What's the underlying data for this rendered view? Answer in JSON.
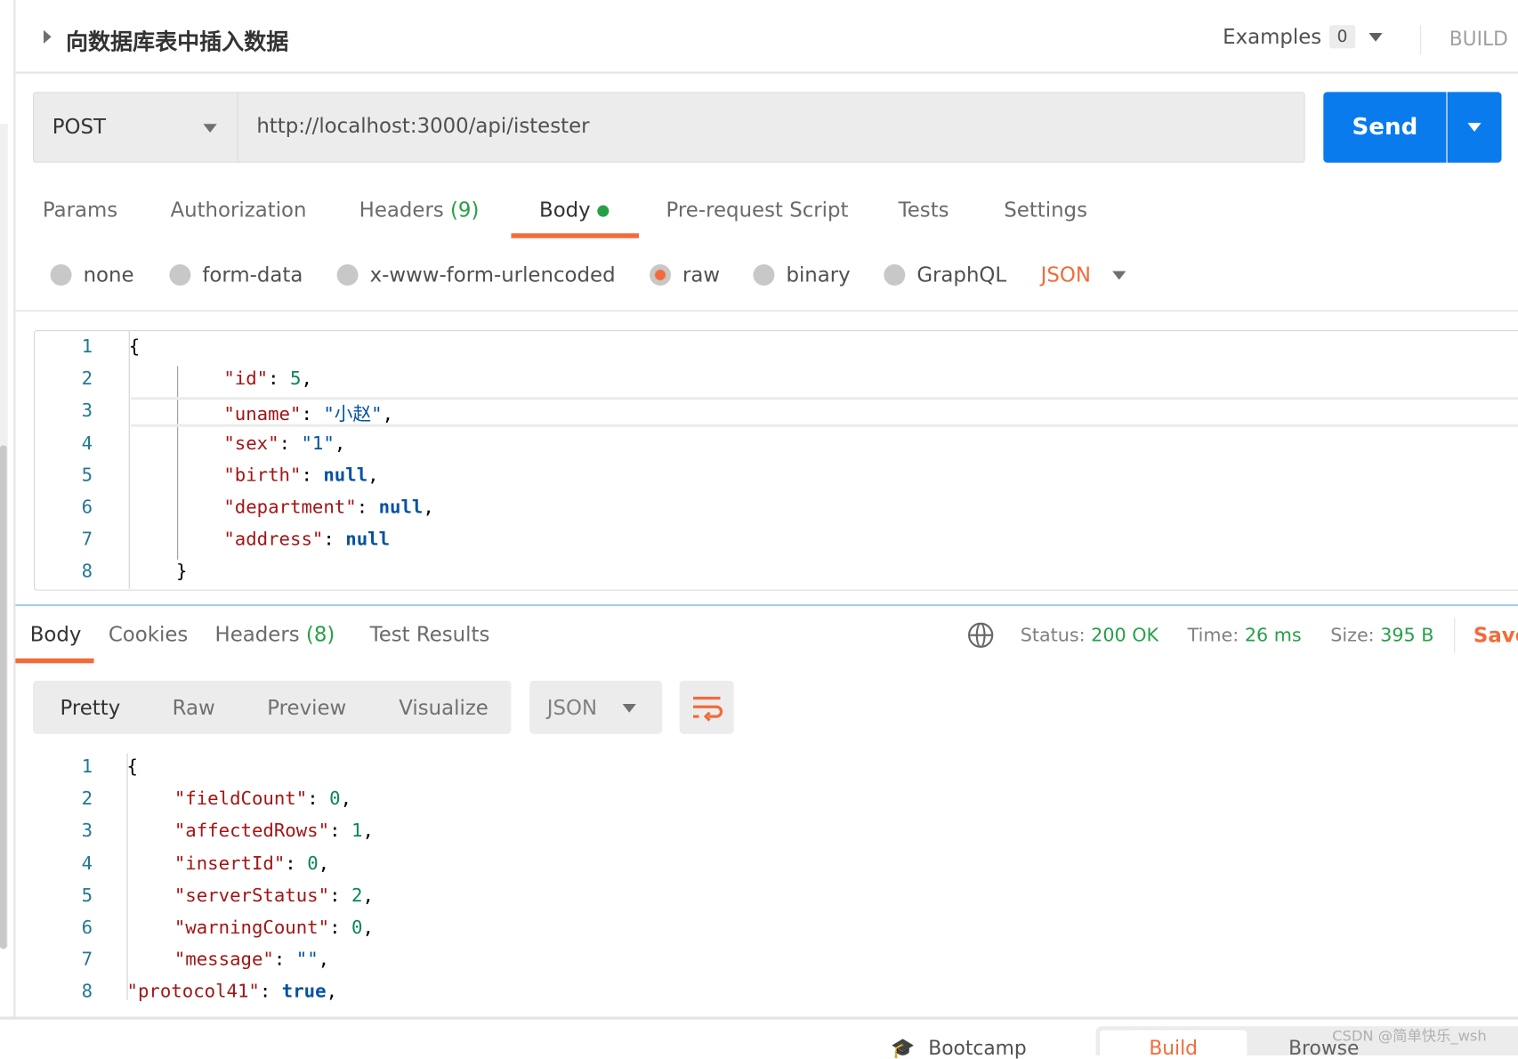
{
  "request": {
    "title": "向数据库表中插入数据",
    "examples_label": "Examples",
    "examples_count": "0",
    "build_label": "BUILD",
    "method": "POST",
    "url": "http://localhost:3000/api/istester",
    "send_label": "Send",
    "tabs": [
      {
        "label": "Params"
      },
      {
        "label": "Authorization"
      },
      {
        "label": "Headers",
        "count": "(9)"
      },
      {
        "label": "Body"
      },
      {
        "label": "Pre-request Script"
      },
      {
        "label": "Tests"
      },
      {
        "label": "Settings"
      }
    ],
    "body_types": [
      {
        "label": "none"
      },
      {
        "label": "form-data"
      },
      {
        "label": "x-www-form-urlencoded"
      },
      {
        "label": "raw",
        "selected": true
      },
      {
        "label": "binary"
      },
      {
        "label": "GraphQL"
      }
    ],
    "body_format": "JSON",
    "code": [
      {
        "n": "1",
        "t": [
          [
            "p",
            "{"
          ]
        ]
      },
      {
        "n": "2",
        "t": [
          [
            "k",
            "\"id\""
          ],
          [
            "p",
            ": "
          ],
          [
            "n",
            "5"
          ],
          [
            "p",
            ","
          ]
        ]
      },
      {
        "n": "3",
        "t": [
          [
            "k",
            "\"uname\""
          ],
          [
            "p",
            ": "
          ],
          [
            "s",
            "\"小赵\""
          ],
          [
            "p",
            ","
          ]
        ]
      },
      {
        "n": "4",
        "t": [
          [
            "k",
            "\"sex\""
          ],
          [
            "p",
            ": "
          ],
          [
            "s",
            "\"1\""
          ],
          [
            "p",
            ","
          ]
        ]
      },
      {
        "n": "5",
        "t": [
          [
            "k",
            "\"birth\""
          ],
          [
            "p",
            ": "
          ],
          [
            "kw",
            "null"
          ],
          [
            "p",
            ","
          ]
        ]
      },
      {
        "n": "6",
        "t": [
          [
            "k",
            "\"department\""
          ],
          [
            "p",
            ": "
          ],
          [
            "kw",
            "null"
          ],
          [
            "p",
            ","
          ]
        ]
      },
      {
        "n": "7",
        "t": [
          [
            "k",
            "\"address\""
          ],
          [
            "p",
            ": "
          ],
          [
            "kw",
            "null"
          ]
        ]
      },
      {
        "n": "8",
        "t": [
          [
            "p",
            "}"
          ]
        ]
      }
    ]
  },
  "response": {
    "tabs": [
      {
        "label": "Body"
      },
      {
        "label": "Cookies"
      },
      {
        "label": "Headers",
        "count": "(8)"
      },
      {
        "label": "Test Results"
      }
    ],
    "status_label": "Status:",
    "status": "200 OK",
    "time_label": "Time:",
    "time": "26 ms",
    "size_label": "Size:",
    "size": "395 B",
    "save_label": "Save",
    "views": [
      "Pretty",
      "Raw",
      "Preview",
      "Visualize"
    ],
    "format": "JSON",
    "code": [
      {
        "n": "1",
        "t": [
          [
            "p",
            "{"
          ]
        ]
      },
      {
        "n": "2",
        "t": [
          [
            "k",
            "\"fieldCount\""
          ],
          [
            "p",
            ": "
          ],
          [
            "n",
            "0"
          ],
          [
            "p",
            ","
          ]
        ]
      },
      {
        "n": "3",
        "t": [
          [
            "k",
            "\"affectedRows\""
          ],
          [
            "p",
            ": "
          ],
          [
            "n",
            "1"
          ],
          [
            "p",
            ","
          ]
        ]
      },
      {
        "n": "4",
        "t": [
          [
            "k",
            "\"insertId\""
          ],
          [
            "p",
            ": "
          ],
          [
            "n",
            "0"
          ],
          [
            "p",
            ","
          ]
        ]
      },
      {
        "n": "5",
        "t": [
          [
            "k",
            "\"serverStatus\""
          ],
          [
            "p",
            ": "
          ],
          [
            "n",
            "2"
          ],
          [
            "p",
            ","
          ]
        ]
      },
      {
        "n": "6",
        "t": [
          [
            "k",
            "\"warningCount\""
          ],
          [
            "p",
            ": "
          ],
          [
            "n",
            "0"
          ],
          [
            "p",
            ","
          ]
        ]
      },
      {
        "n": "7",
        "t": [
          [
            "k",
            "\"message\""
          ],
          [
            "p",
            ": "
          ],
          [
            "s",
            "\"\""
          ],
          [
            "p",
            ","
          ]
        ]
      },
      {
        "n": "8",
        "t": [
          [
            "k",
            "\"protocol41\""
          ],
          [
            "p",
            ": "
          ],
          [
            "kw",
            "true"
          ],
          [
            "p",
            ","
          ]
        ]
      }
    ]
  },
  "footer": {
    "bootcamp": "Bootcamp",
    "build": "Build",
    "browse": "Browse",
    "watermark": "CSDN @简单快乐_wsh"
  },
  "colors": {
    "accent": "#f26b3a",
    "send": "#097bed",
    "green": "#26a046"
  }
}
